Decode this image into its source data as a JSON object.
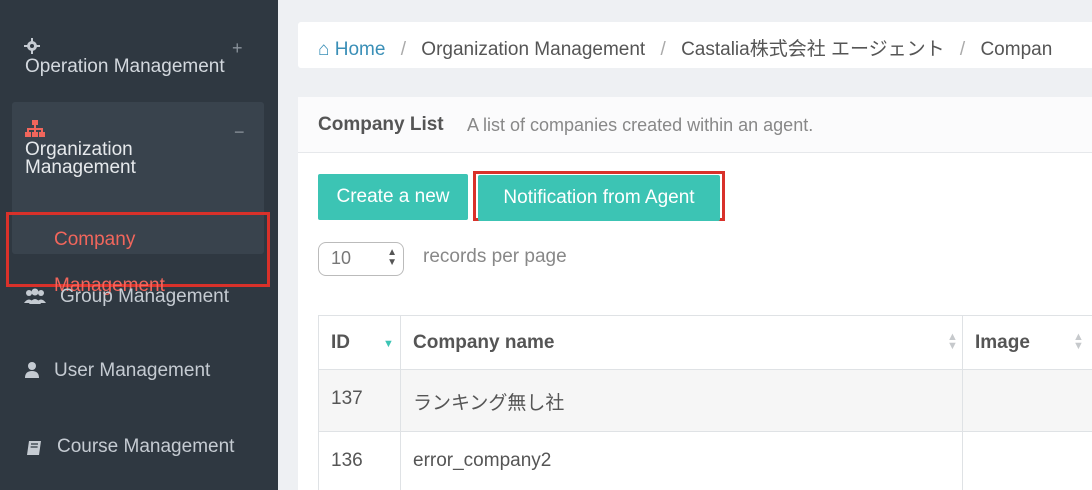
{
  "sidebar": {
    "operation": {
      "label": "Operation Management",
      "toggle": "+"
    },
    "organization": {
      "label": "Organization Management",
      "toggle": "−"
    },
    "company": {
      "label": "Company Management"
    },
    "group": {
      "label": "Group Management"
    },
    "user": {
      "label": "User Management"
    },
    "course": {
      "label": "Course Management"
    },
    "icons": {
      "operation": "gear-icon",
      "organization": "sitemap-icon",
      "group": "users-icon",
      "user": "user-icon",
      "course": "book-icon"
    }
  },
  "breadcrumb": {
    "home": "Home",
    "items": [
      "Organization Management",
      "Castalia株式会社 エージェント",
      "Compan"
    ],
    "separator": "/"
  },
  "panel": {
    "title": "Company List",
    "description": "A list of companies created within an agent."
  },
  "buttons": {
    "create": "Create a new",
    "notify": "Notification from Agent"
  },
  "pagination": {
    "per_page_value": "10",
    "per_page_label": "records per page"
  },
  "table": {
    "columns": [
      "ID",
      "Company name",
      "Image"
    ],
    "rows": [
      {
        "id": "137",
        "name": "ランキング無し社",
        "image": ""
      },
      {
        "id": "136",
        "name": "error_company2",
        "image": ""
      }
    ]
  },
  "colors": {
    "sidebar_bg": "#2f3841",
    "accent": "#3cc4b4",
    "highlight": "#d9312a",
    "active_text": "#f1665c",
    "link": "#3a8fb7"
  }
}
